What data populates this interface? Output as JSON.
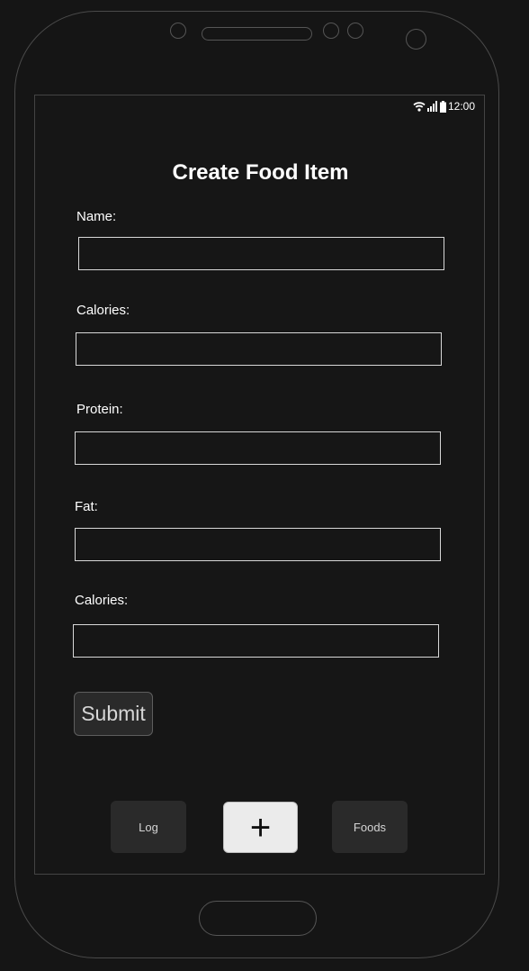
{
  "status_bar": {
    "time": "12:00",
    "icons": [
      "wifi-icon",
      "signal-icon",
      "battery-icon"
    ]
  },
  "form": {
    "title": "Create Food Item",
    "fields": [
      {
        "label": "Name:",
        "value": "",
        "placeholder": ""
      },
      {
        "label": "Calories:",
        "value": "",
        "placeholder": ""
      },
      {
        "label": "Protein:",
        "value": "",
        "placeholder": ""
      },
      {
        "label": "Fat:",
        "value": "",
        "placeholder": ""
      },
      {
        "label": "Calories:",
        "value": "",
        "placeholder": ""
      }
    ],
    "submit_label": "Submit"
  },
  "bottom_nav": {
    "items": [
      {
        "label": "Log"
      },
      {
        "label": "+",
        "icon": "plus-icon"
      },
      {
        "label": "Foods"
      }
    ]
  },
  "colors": {
    "background": "#151515",
    "screen": "#161616",
    "text": "#ffffff",
    "input_border": "#d8d8d8",
    "button_bg": "#2a2a2a",
    "add_button_bg": "#ebebeb"
  }
}
